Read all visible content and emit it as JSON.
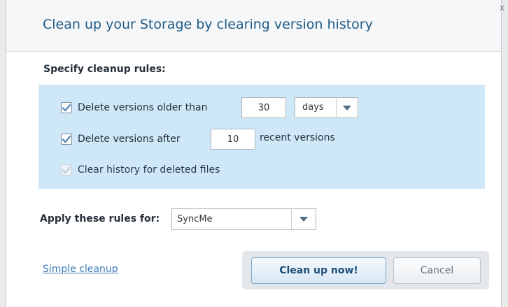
{
  "dialog": {
    "title": "Clean up your Storage by clearing version history",
    "close_glyph": "x"
  },
  "rules": {
    "section_label": "Specify cleanup rules:",
    "older_than": {
      "checked": true,
      "label": "Delete versions older than",
      "value": "30",
      "unit": "days"
    },
    "after_recent": {
      "checked": true,
      "label": "Delete versions after",
      "value": "10",
      "suffix": "recent versions"
    },
    "clear_deleted": {
      "checked": true,
      "disabled": true,
      "label": "Clear history for deleted files"
    }
  },
  "apply": {
    "label": "Apply these rules for:",
    "selected": "SyncMe"
  },
  "footer": {
    "simple_link": "Simple cleanup",
    "primary_button": "Clean up now!",
    "cancel_button": "Cancel"
  },
  "icons": {
    "checkmark": "check-icon",
    "dropdown": "chevron-down-icon",
    "close": "close-icon"
  },
  "colors": {
    "title": "#1f5b86",
    "rules_bg": "#cfe8f8",
    "link": "#3d7ab8",
    "check": "#5b89b8"
  }
}
